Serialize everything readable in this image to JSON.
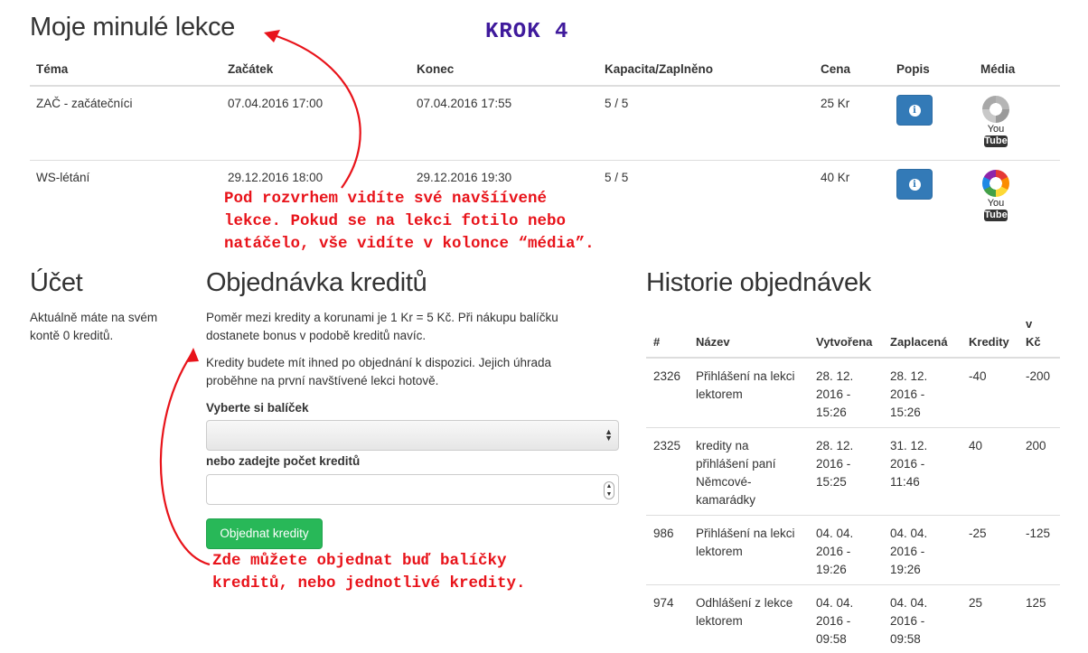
{
  "page": {
    "lessons_title": "Moje minulé lekce",
    "step": "KROK 4"
  },
  "lessons_table": {
    "headers": [
      "Téma",
      "Začátek",
      "Konec",
      "Kapacita/Zaplněno",
      "Cena",
      "Popis",
      "Média"
    ],
    "rows": [
      {
        "topic": "ZAČ - začátečníci",
        "start": "07.04.2016 17:00",
        "end": "07.04.2016 17:55",
        "capacity": "5 / 5",
        "price": "25 Kr",
        "media": "gray-picasa-youtube"
      },
      {
        "topic": "WS-létání",
        "start": "29.12.2016 18:00",
        "end": "29.12.2016 19:30",
        "capacity": "5 / 5",
        "price": "40 Kr",
        "media": "color-picasa-youtube"
      }
    ],
    "info_glyph": "i",
    "youtube_you": "You",
    "youtube_tube": "Tube"
  },
  "annotations": {
    "media_note": "Pod rozvrhem vidíte své navšíívené\nlekce. Pokud se na lekci fotilo nebo\nnatáčelo, vše vidíte v kolonce “média”.",
    "order_note": "Zde můžete objednat buď balíčky\nkreditů, nebo jednotlivé kredity.",
    "color": "#e8131a"
  },
  "account": {
    "title": "Účet",
    "text": "Aktuálně máte na svém kontě 0 kreditů."
  },
  "order": {
    "title": "Objednávka kreditů",
    "p1": "Poměr mezi kredity a korunami je 1 Kr = 5 Kč. Při nákupu balíčku dostanete bonus v podobě kreditů navíc.",
    "p2": "Kredity budete mít ihned po objednání k dispozici. Jejich úhrada proběhne na první navštívené lekci hotově.",
    "package_label": "Vyberte si balíček",
    "package_value": "",
    "count_label": "nebo zadejte počet kreditů",
    "count_value": "",
    "button": "Objednat kredity",
    "button_color": "#28b858"
  },
  "history": {
    "title": "Historie objednávek",
    "headers": [
      "#",
      "Název",
      "Vytvořena",
      "Zaplacená",
      "Kredity",
      "v Kč"
    ],
    "rows": [
      {
        "id": "2326",
        "name": "Přihlášení na lekci lektorem",
        "created": "28. 12. 2016 - 15:26",
        "paid": "28. 12. 2016 - 15:26",
        "credits": "-40",
        "czk": "-200"
      },
      {
        "id": "2325",
        "name": "kredity na přihlášení paní Němcové-kamarádky",
        "created": "28. 12. 2016 - 15:25",
        "paid": "31. 12. 2016 - 11:46",
        "credits": "40",
        "czk": "200"
      },
      {
        "id": "986",
        "name": "Přihlášení na lekci lektorem",
        "created": "04. 04. 2016 - 19:26",
        "paid": "04. 04. 2016 - 19:26",
        "credits": "-25",
        "czk": "-125"
      },
      {
        "id": "974",
        "name": "Odhlášení z lekce lektorem",
        "created": "04. 04. 2016 - 09:58",
        "paid": "04. 04. 2016 - 09:58",
        "credits": "25",
        "czk": "125"
      }
    ]
  }
}
